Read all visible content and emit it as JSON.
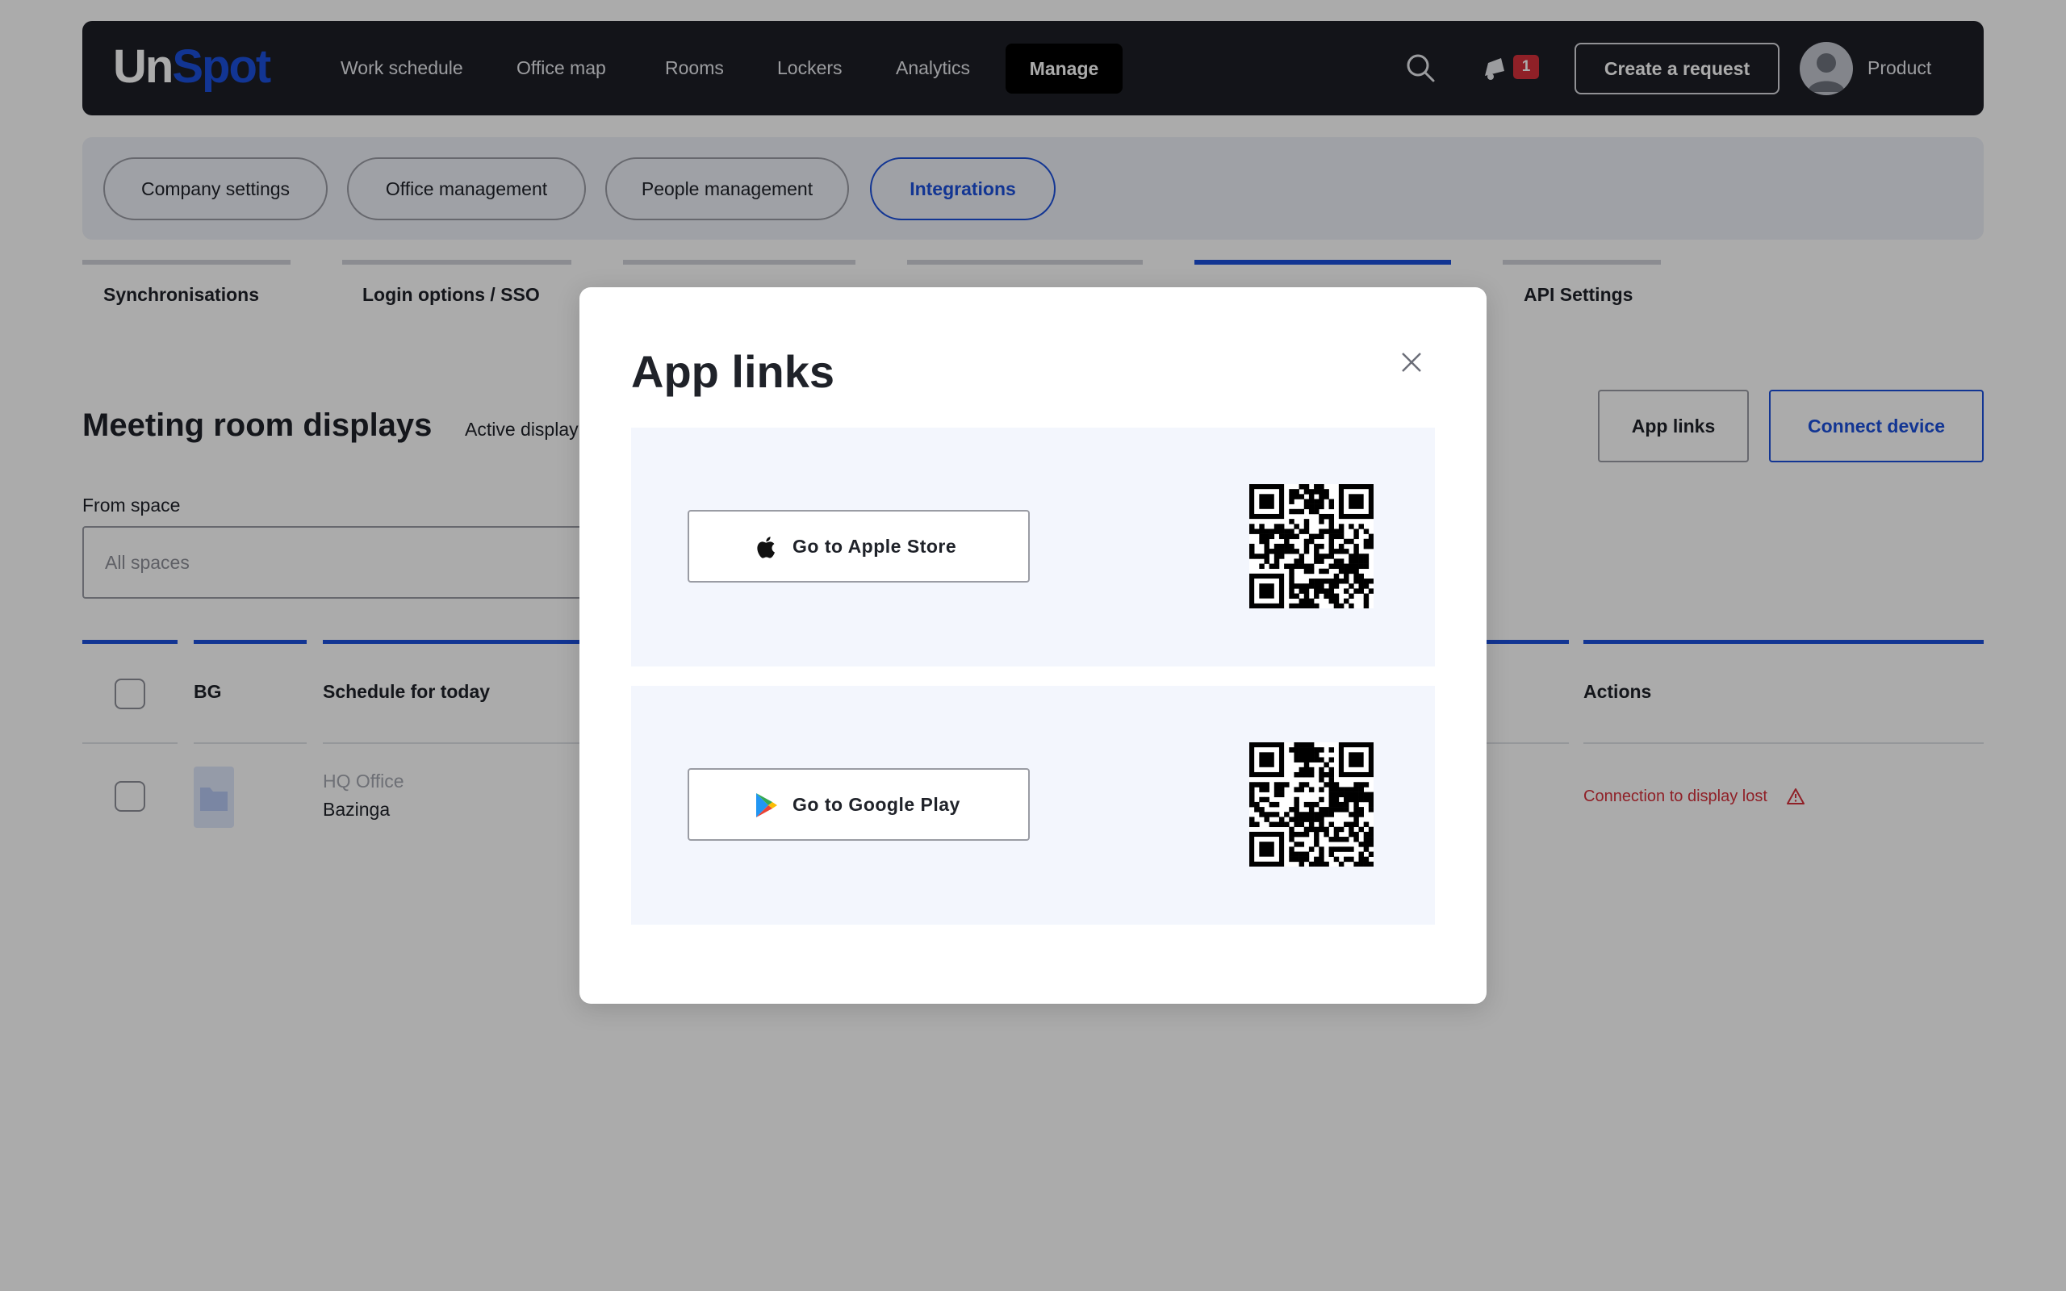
{
  "brand": {
    "logo_part1": "Un",
    "logo_part2": "Spot"
  },
  "topnav": {
    "items": [
      "Work schedule",
      "Office map",
      "Rooms",
      "Lockers",
      "Analytics"
    ],
    "active": "Manage",
    "notification_count": "1",
    "create_request": "Create a request",
    "user_name": "Product"
  },
  "categories": [
    "Company settings",
    "Office management",
    "People management",
    "Integrations"
  ],
  "subtabs": [
    "Synchronisations",
    "Login options / SSO",
    "API Settings"
  ],
  "page": {
    "title": "Meeting room displays",
    "subtitle": "Active display",
    "app_links_button": "App links",
    "connect_button": "Connect device",
    "filter_label": "From space",
    "filter_placeholder": "All spaces"
  },
  "table": {
    "headers": [
      "BG",
      "Schedule for today",
      "Actions"
    ],
    "rows": [
      {
        "location": "HQ Office",
        "room": "Bazinga",
        "status": "Connection to display lost"
      }
    ]
  },
  "modal": {
    "title": "App links",
    "apple_button": "Go to Apple Store",
    "google_button": "Go to Google Play"
  },
  "colors": {
    "brand_blue": "#1b4fdb",
    "nav_bg": "#1d1f26",
    "error_red": "#d6303b",
    "panel_bg": "#f3f6fd"
  }
}
